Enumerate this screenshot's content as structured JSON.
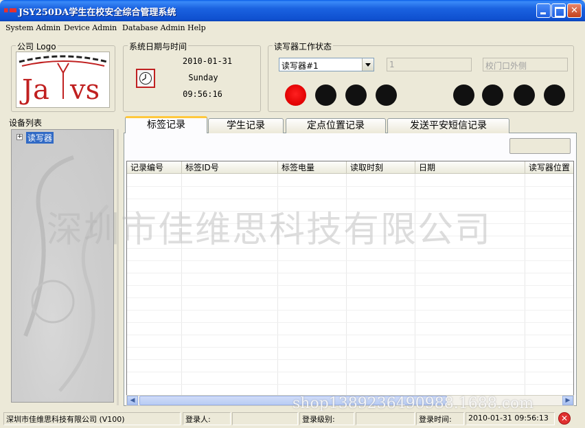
{
  "window": {
    "title": "JSY250DA学生在校安全综合管理系统"
  },
  "menu": [
    "System Admin",
    "Device Admin",
    "Database Admin",
    "Help"
  ],
  "logo_group": {
    "title": "公司 Logo",
    "logo_text": "Jarvs"
  },
  "datetime_group": {
    "title": "系统日期与时间",
    "date": "2010-01-31",
    "weekday": "Sunday",
    "time": "09:56:16"
  },
  "reader_group": {
    "title": "读写器工作状态",
    "selected_reader": "读写器#1",
    "reader_number": "1",
    "reader_location": "校门口外侧",
    "leds": [
      "red",
      "black",
      "black",
      "black",
      "black",
      "black",
      "black",
      "black"
    ],
    "colors": {
      "active": "#e00000",
      "inactive": "#111111"
    }
  },
  "device_list": {
    "title": "设备列表",
    "root_node": "读写器"
  },
  "tabs": [
    "标签记录",
    "学生记录",
    "定点位置记录",
    "发送平安短信记录"
  ],
  "grid": {
    "columns": [
      "记录编号",
      "标签ID号",
      "标签电量",
      "读取时刻",
      "日期",
      "读写器位置"
    ]
  },
  "watermark": "深圳市佳维思科技有限公司",
  "watermark_url": "shop1389236490988.1688.com",
  "status": {
    "company": "深圳市佳维思科技有限公司 (V100)",
    "login_user_label": "登录人:",
    "login_user": "",
    "login_level_label": "登录级别:",
    "login_level": "",
    "login_time_label": "登录时间:",
    "login_time": "2010-01-31  09:56:13"
  }
}
